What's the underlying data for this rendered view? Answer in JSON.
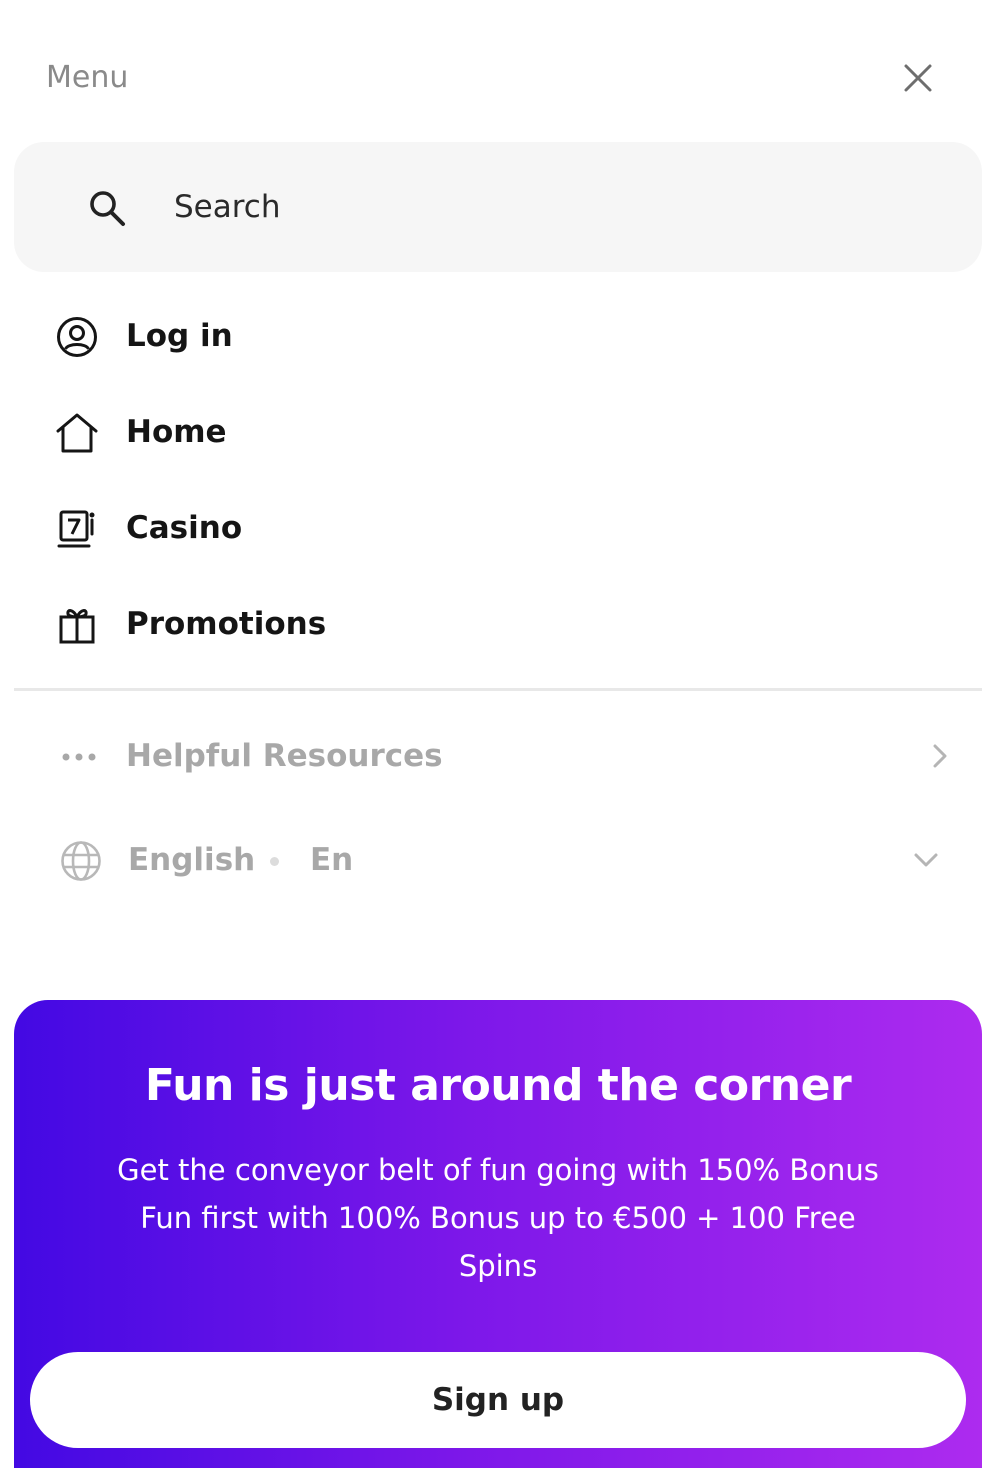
{
  "header": {
    "title": "Menu",
    "close_icon": "close-icon"
  },
  "search": {
    "placeholder": "Search",
    "icon": "search-icon"
  },
  "nav": {
    "items": [
      {
        "label": "Log in",
        "icon": "user-circle-icon"
      },
      {
        "label": "Home",
        "icon": "home-icon"
      },
      {
        "label": "Casino",
        "icon": "slot-machine-icon"
      },
      {
        "label": "Promotions",
        "icon": "gift-icon"
      }
    ]
  },
  "resources": {
    "label": "Helpful Resources",
    "icon": "more-dots-icon",
    "chevron": "chevron-right-icon"
  },
  "language": {
    "label": "English",
    "code": "En",
    "icon": "globe-icon",
    "chevron": "chevron-down-icon"
  },
  "promo": {
    "title": "Fun is just around the corner",
    "text": "Get the conveyor belt of fun going with 150% Bonus Fun first with 100% Bonus up to €500 + 100 Free Spins",
    "button_label": "Sign up"
  },
  "colors": {
    "gradient_start": "#4309e3",
    "gradient_mid": "#7b17e9",
    "gradient_end": "#ad2bef",
    "search_bg": "#f6f6f6",
    "muted_text": "#a8a8a8"
  }
}
